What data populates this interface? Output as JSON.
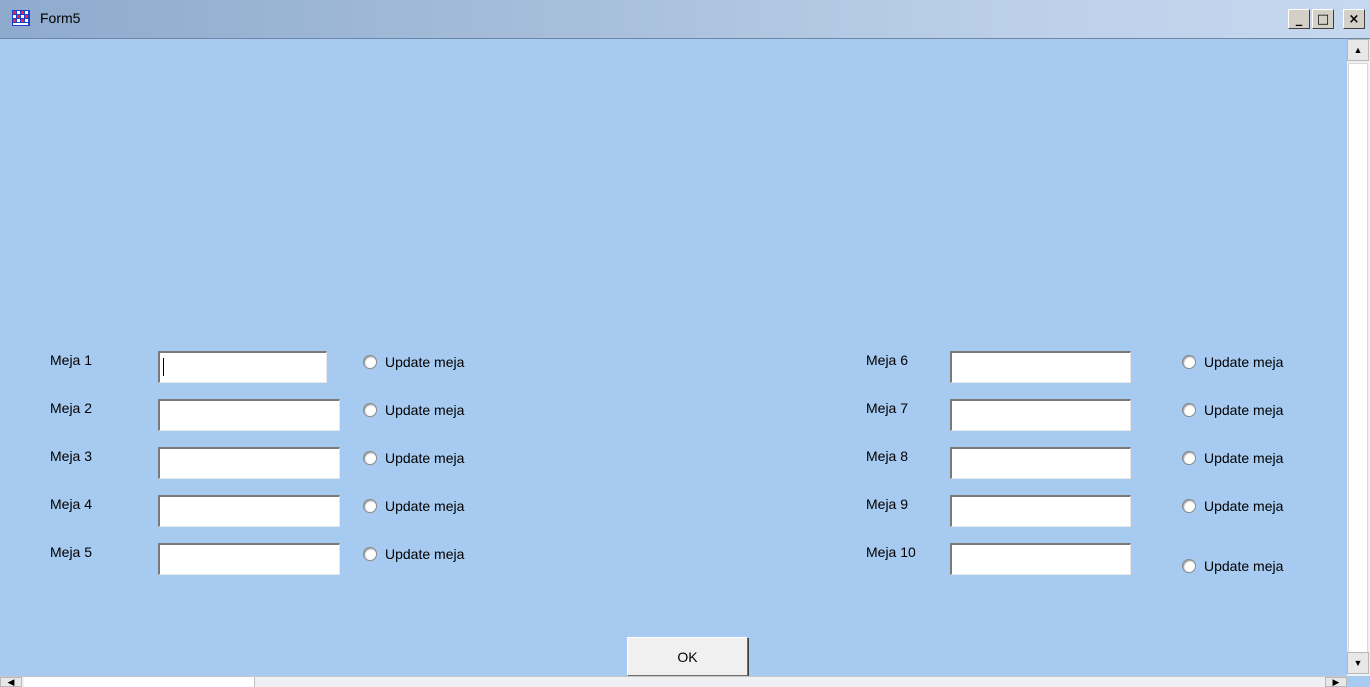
{
  "window": {
    "title": "Form5",
    "icon": "app-grid-icon",
    "controls": {
      "minimize": "_",
      "maximize": "□",
      "close": "×"
    }
  },
  "form": {
    "rows": [
      {
        "label": "Meja 1",
        "value": "",
        "radio_label": "Update meja",
        "checked": false
      },
      {
        "label": "Meja 2",
        "value": "",
        "radio_label": "Update meja",
        "checked": false
      },
      {
        "label": "Meja 3",
        "value": "",
        "radio_label": "Update meja",
        "checked": false
      },
      {
        "label": "Meja 4",
        "value": "",
        "radio_label": "Update meja",
        "checked": false
      },
      {
        "label": "Meja 5",
        "value": "",
        "radio_label": "Update meja",
        "checked": false
      },
      {
        "label": "Meja 6",
        "value": "",
        "radio_label": "Update meja",
        "checked": false
      },
      {
        "label": "Meja 7",
        "value": "",
        "radio_label": "Update meja",
        "checked": false
      },
      {
        "label": "Meja 8",
        "value": "",
        "radio_label": "Update meja",
        "checked": false
      },
      {
        "label": "Meja 9",
        "value": "",
        "radio_label": "Update meja",
        "checked": false
      },
      {
        "label": "Meja 10",
        "value": "",
        "radio_label": "Update meja",
        "checked": false
      }
    ],
    "ok_label": "OK"
  },
  "scrollbars": {
    "up": "▲",
    "down": "▼",
    "left": "◀",
    "right": "▶"
  },
  "colors": {
    "form_background": "#a6caf0"
  }
}
